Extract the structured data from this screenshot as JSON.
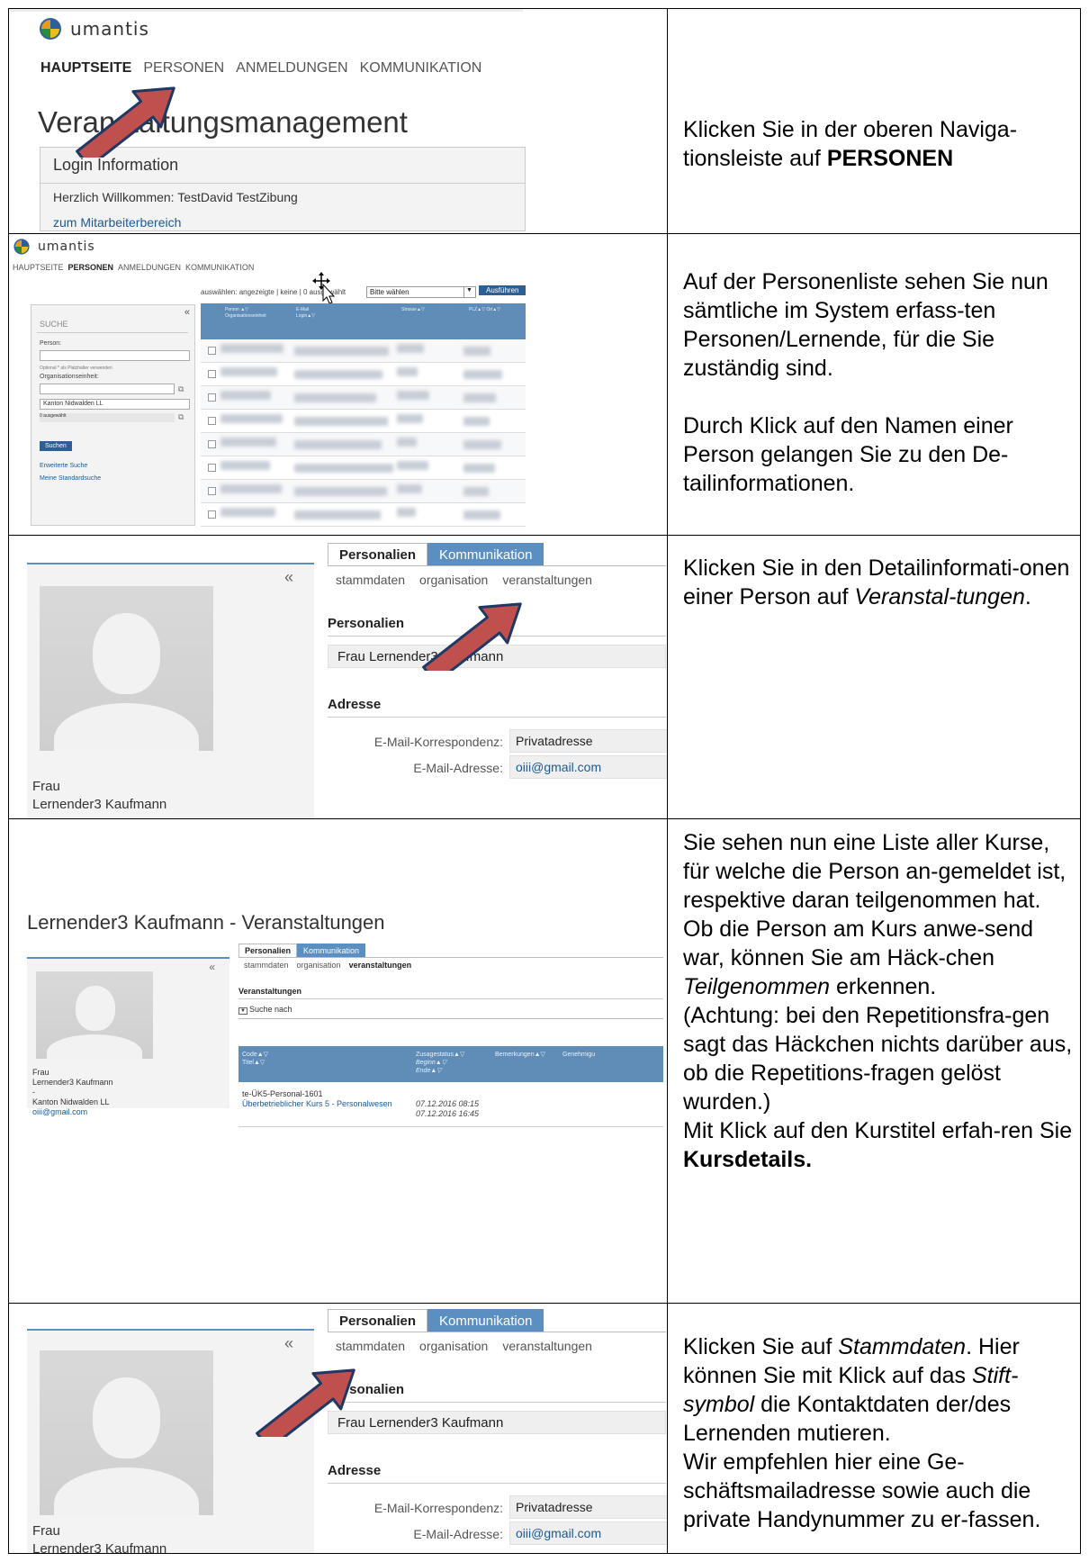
{
  "app": {
    "logo_text": "umantis"
  },
  "nav": [
    "HAUPTSEITE",
    "PERSONEN",
    "ANMELDUNGEN",
    "KOMMUNIKATION"
  ],
  "row1": {
    "page_title": "Veranstaltungsmanagement",
    "login_header": "Login Information",
    "welcome": "Herzlich Willkommen: TestDavid TestZibung",
    "link": "zum Mitarbeiterbereich",
    "instruction_prefix": "Klicken Sie in der oberen Naviga-tionsleiste auf ",
    "instruction_bold": "PERSONEN"
  },
  "row2": {
    "toolbar_label": "auswählen: angezeigte | keine | 0 ausgewählt",
    "select_value": "Bitte wählen",
    "execute_button": "Ausführen",
    "search_title": "SUCHE",
    "person_label": "Person:",
    "optional_hint": "Optional * als Platzhalter verwenden",
    "org_label": "Organisationseinheit:",
    "org_value": "Kanton Nidwalden LL",
    "selected_count": "0 ausgewählt",
    "search_button": "Suchen",
    "advanced_search": "Erweiterte Suche",
    "standard_search": "Meine Standardsuche",
    "col_person": "Person ▲▽",
    "col_org": "Organisationseinheit",
    "col_email": "E-Mail",
    "col_login": "Login▲▽",
    "col_street": "Strasse▲▽",
    "col_plz": "PLZ▲▽ Ort▲▽",
    "paragraph1": "Auf der Personenliste sehen Sie nun sämtliche im System erfass-ten Personen/Lernende, für die Sie zuständig sind.",
    "paragraph2": "Durch Klick auf den Namen einer Person gelangen Sie zu den De-tailinformationen."
  },
  "person": {
    "tab1": "Personalien",
    "tab2": "Kommunikation",
    "sub": [
      "stammdaten",
      "organisation",
      "veranstaltungen"
    ],
    "section_personalien": "Personalien",
    "full_name": "Frau Lernender3 Kaufmann",
    "section_adresse": "Adresse",
    "email_corr_label": "E-Mail-Korrespondenz:",
    "email_corr_value": "Privatadresse",
    "email_label": "E-Mail-Adresse:",
    "email_value": "oiii@gmail.com",
    "salutation": "Frau",
    "name": "Lernender3 Kaufmann"
  },
  "row3": {
    "instruction_prefix": "Klicken Sie in den Detailinformati-onen einer Person auf ",
    "instruction_italic": "Veranstal-tungen",
    "instruction_suffix": "."
  },
  "row4": {
    "heading": "Lernender3 Kaufmann - Veranstaltungen",
    "section": "Veranstaltungen",
    "search_toggle": "Suche nach",
    "col_code": "Code▲▽",
    "col_titel": "Titel▲▽",
    "col_status": "Zusagestatus▲▽",
    "col_beginn": "Beginn▲▽",
    "col_ende": "Ende▲▽",
    "col_remarks": "Bemerkungen▲▽",
    "col_approval": "Genehmigu",
    "course_code": "te-ÜK5-Personal-1601",
    "course_title": "Überbetrieblicher Kurs 5 - Personalwesen",
    "begin": "07.12.2016 08:15",
    "end": "07.12.2016 16:45",
    "side_salutation": "Frau",
    "side_name": "Lernender3 Kaufmann",
    "side_dash": "-",
    "side_org": "Kanton Nidwalden LL",
    "side_email": "oiii@gmail.com",
    "p1": "Sie sehen nun eine Liste aller Kurse, für welche die Person an-gemeldet ist, respektive daran teilgenommen hat.",
    "p2_a": "Ob die Person am Kurs anwe-send war, können Sie am Häck-chen ",
    "p2_italic": "Teilgenommen",
    "p2_b": " erkennen.",
    "p3": "(Achtung: bei den Repetitionsfra-gen sagt das Häckchen nichts darüber aus, ob die Repetitions-fragen gelöst wurden.)",
    "p4_a": "Mit Klick auf den Kurstitel erfah-ren Sie ",
    "p4_bold": "Kursdetails."
  },
  "row5": {
    "t1": "Klicken Sie auf ",
    "i1": "Stammdaten",
    "t2": ". Hier können Sie mit Klick auf das ",
    "i2": "Stift-symbol",
    "t3": " die Kontaktdaten der/des Lernenden mutieren.",
    "p2": "Wir empfehlen hier eine Ge-schäftsmailadresse sowie auch die private Handynummer zu er-fassen."
  },
  "colors": {
    "arrow_fill": "#c0504d",
    "arrow_stroke": "#1f3864",
    "tab_blue": "#5b8fc1",
    "link": "#1a5a9a"
  }
}
